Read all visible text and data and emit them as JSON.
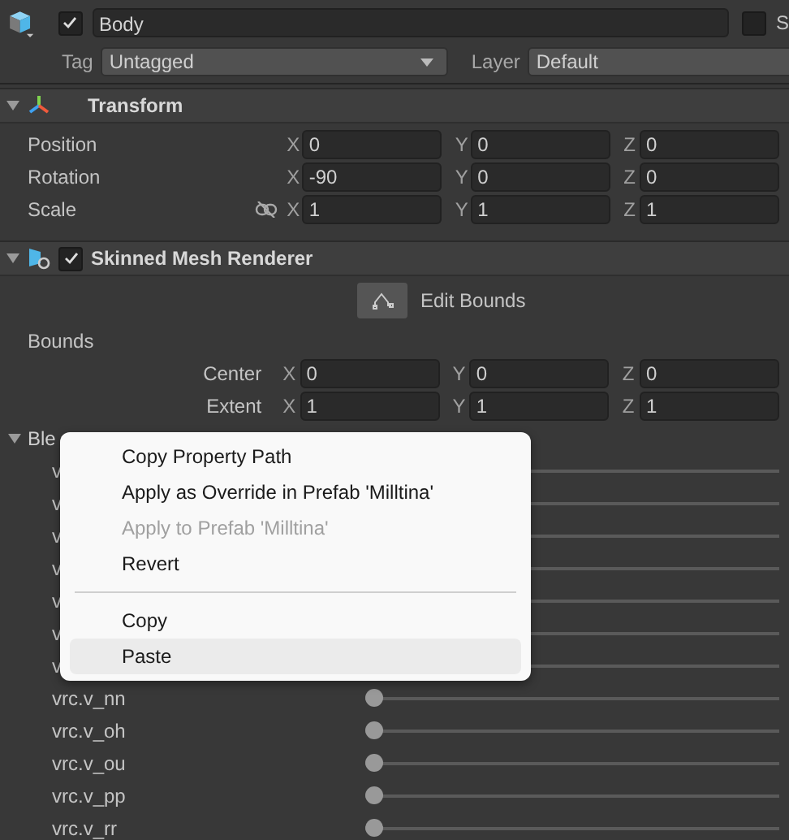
{
  "header": {
    "active": true,
    "name": "Body",
    "static_label": "S",
    "static": false,
    "tag_label": "Tag",
    "tag": "Untagged",
    "layer_label": "Layer",
    "layer": "Default"
  },
  "transform": {
    "title": "Transform",
    "expanded": true,
    "rows": [
      {
        "label": "Position",
        "fields": [
          {
            "axis": "X",
            "value": "0"
          },
          {
            "axis": "Y",
            "value": "0"
          },
          {
            "axis": "Z",
            "value": "0"
          }
        ]
      },
      {
        "label": "Rotation",
        "fields": [
          {
            "axis": "X",
            "value": "-90"
          },
          {
            "axis": "Y",
            "value": "0"
          },
          {
            "axis": "Z",
            "value": "0"
          }
        ]
      },
      {
        "label": "Scale",
        "proportional": false,
        "fields": [
          {
            "axis": "X",
            "value": "1"
          },
          {
            "axis": "Y",
            "value": "1"
          },
          {
            "axis": "Z",
            "value": "1"
          }
        ]
      }
    ]
  },
  "renderer": {
    "title": "Skinned Mesh Renderer",
    "enabled": true,
    "expanded": true,
    "edit_bounds": "Edit Bounds",
    "bounds_label": "Bounds",
    "bounds": [
      {
        "label": "Center",
        "fields": [
          {
            "axis": "X",
            "value": "0"
          },
          {
            "axis": "Y",
            "value": "0"
          },
          {
            "axis": "Z",
            "value": "0"
          }
        ]
      },
      {
        "label": "Extent",
        "fields": [
          {
            "axis": "X",
            "value": "1"
          },
          {
            "axis": "Y",
            "value": "1"
          },
          {
            "axis": "Z",
            "value": "1"
          }
        ]
      }
    ],
    "blend_title": "Ble",
    "blend_expanded": true,
    "blend_shapes": [
      {
        "name": "v"
      },
      {
        "name": "v"
      },
      {
        "name": "v"
      },
      {
        "name": "v"
      },
      {
        "name": "v"
      },
      {
        "name": "v"
      },
      {
        "name": "v"
      },
      {
        "name": "vrc.v_nn",
        "level": 0
      },
      {
        "name": "vrc.v_oh",
        "level": 0
      },
      {
        "name": "vrc.v_ou",
        "level": 0
      },
      {
        "name": "vrc.v_pp",
        "level": 0
      },
      {
        "name": "vrc.v_rr",
        "level": 0
      }
    ]
  },
  "context_menu": {
    "items": [
      {
        "kind": "item",
        "label": "Copy Property Path",
        "disabled": false,
        "selected": false
      },
      {
        "kind": "item",
        "label": "Apply as Override in Prefab 'Milltina'",
        "disabled": false,
        "selected": false
      },
      {
        "kind": "item",
        "label": "Apply to Prefab 'Milltina'",
        "disabled": true,
        "selected": false
      },
      {
        "kind": "item",
        "label": "Revert",
        "disabled": false,
        "selected": false
      },
      {
        "kind": "separator"
      },
      {
        "kind": "item",
        "label": "Copy",
        "disabled": false,
        "selected": false
      },
      {
        "kind": "item",
        "label": "Paste",
        "disabled": false,
        "selected": true
      }
    ]
  }
}
